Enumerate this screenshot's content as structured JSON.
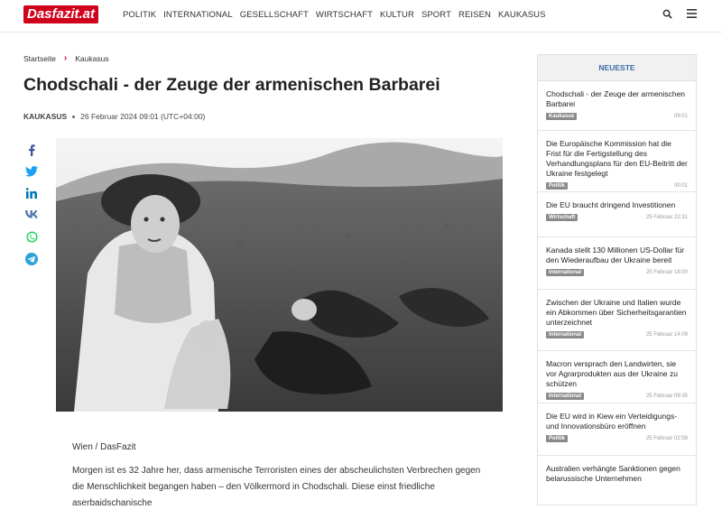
{
  "header": {
    "logo_text": "Dasfazit.at",
    "nav": [
      "POLITIK",
      "INTERNATIONAL",
      "GESELLSCHAFT",
      "WIRTSCHAFT",
      "KULTUR",
      "SPORT",
      "REISEN",
      "KAUKASUS"
    ],
    "icons": [
      "search-icon",
      "hamburger-menu-icon"
    ]
  },
  "breadcrumb": {
    "home": "Startseite",
    "current": "Kaukasus"
  },
  "article": {
    "title": "Chodschali - der Zeuge der armenischen Barbarei",
    "category": "KAUKASUS",
    "date": "26 Februar 2024 09:01 (UTC+04:00)",
    "dateline": "Wien / DasFazit",
    "paragraph1": "Morgen ist es 32 Jahre her, dass armenische Terroristen eines der abscheulichsten Verbrechen gegen die Menschlichkeit begangen haben – den Völkermord in Chodschali. Diese einst friedliche aserbaidschanische"
  },
  "share": [
    "facebook-icon",
    "twitter-icon",
    "linkedin-icon",
    "vk-icon",
    "whatsapp-icon",
    "telegram-icon"
  ],
  "share_colors": {
    "facebook": "#3b5998",
    "twitter": "#1da1f2",
    "linkedin": "#0077b5",
    "vk": "#4a76a8",
    "whatsapp": "#25d366",
    "telegram": "#2aa3d8"
  },
  "sidebar": {
    "heading": "NEUESTE",
    "items": [
      {
        "title": "Chodschali - der Zeuge der armenischen Barbarei",
        "badge": "Kaukasus",
        "time": "09:01"
      },
      {
        "title": "Die Europäische Kommission hat die Frist für die Fertigstellung des Verhandlungsplans für den EU-Beitritt der Ukraine festgelegt",
        "badge": "Politik",
        "time": "00:01"
      },
      {
        "title": "Die EU braucht dringend Investitionen",
        "badge": "Wirtschaft",
        "time": "25 Februar 22:31"
      },
      {
        "title": "Kanada stellt 130 Millionen US-Dollar für den Wiederaufbau der Ukraine bereit",
        "badge": "International",
        "time": "25 Februar 18:00"
      },
      {
        "title": "Zwischen der Ukraine und Italien wurde ein Abkommen über Sicherheitsgarantien unterzeichnet",
        "badge": "International",
        "time": "25 Februar 14:09"
      },
      {
        "title": "Macron versprach den Landwirten, sie vor Agrarprodukten aus der Ukraine zu schützen",
        "badge": "International",
        "time": "25 Februar 09:35"
      },
      {
        "title": "Die EU wird in Kiew ein Verteidigungs- und Innovationsbüro eröffnen",
        "badge": "Politik",
        "time": "25 Februar 02:58"
      },
      {
        "title": "Australien verhängte Sanktionen gegen belarussische Unternehmen",
        "badge": "",
        "time": ""
      }
    ]
  },
  "colors": {
    "brand": "#d0021b",
    "sidebar_heading": "#3a6ea5"
  }
}
